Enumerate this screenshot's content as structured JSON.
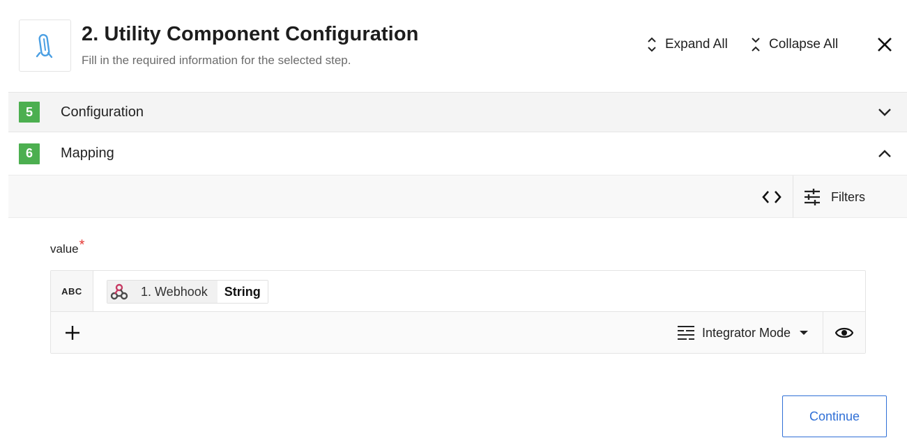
{
  "header": {
    "title": "2. Utility Component Configuration",
    "subtitle": "Fill in the required information for the selected step.",
    "logo_icon": "utility-tool-icon",
    "expand_all_label": "Expand All",
    "collapse_all_label": "Collapse All"
  },
  "sections": [
    {
      "number": "5",
      "label": "Configuration",
      "state": "collapsed"
    },
    {
      "number": "6",
      "label": "Mapping",
      "state": "expanded"
    }
  ],
  "toolbar": {
    "filters_label": "Filters"
  },
  "field": {
    "label": "value",
    "required_mark": "*",
    "type_label": "ABC",
    "token": {
      "source": "1. Webhook",
      "type": "String",
      "icon": "webhook-icon"
    },
    "mode_label": "Integrator Mode"
  },
  "footer": {
    "continue_label": "Continue"
  },
  "colors": {
    "badge": "#4caf50",
    "accent": "#2f6fd6",
    "required": "#e53935",
    "logo": "#4a9fe3"
  }
}
